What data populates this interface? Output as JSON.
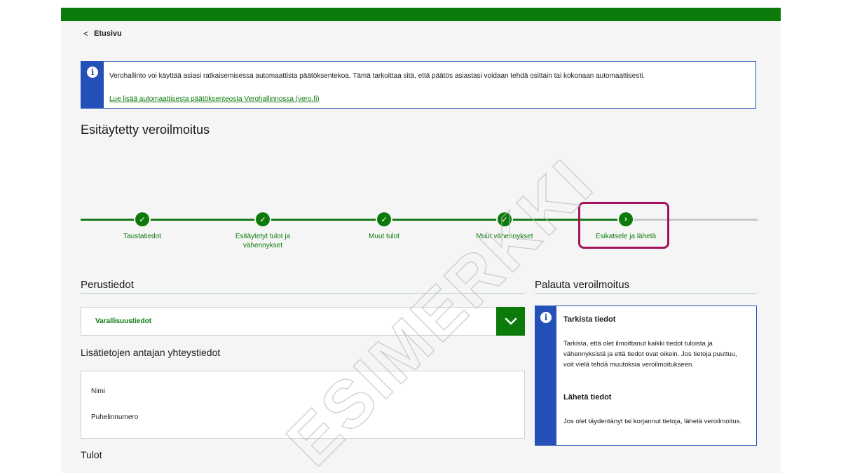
{
  "colors": {
    "brand_green": "#0b7a0b",
    "info_blue": "#2451b7",
    "highlight": "#a4145f"
  },
  "nav": {
    "back_label": "Etusivu"
  },
  "notice": {
    "text": "Verohallinto voi käyttää asiasi ratkaisemisessa automaattista päätöksentekoa. Tämä tarkoittaa sitä, että päätös asiastasi voidaan tehdä osittain tai kokonaan automaattisesti.",
    "link": "Lue lisää automaattisesta päätöksenteosta Verohallinnossa (vero.fi)"
  },
  "page_title": "Esitäytetty veroilmoitus",
  "stepper": {
    "steps": [
      {
        "label": "Taustatiedot",
        "state": "done",
        "icon": "check-icon"
      },
      {
        "label": "Esitäytetyt tulot ja vähennykset",
        "state": "done",
        "icon": "check-icon"
      },
      {
        "label": "Muut tulot",
        "state": "done",
        "icon": "check-icon"
      },
      {
        "label": "Muut vähennykset",
        "state": "done",
        "icon": "check-icon"
      },
      {
        "label": "Esikatsele ja lähetä",
        "state": "current",
        "icon": "chevron-right-icon"
      }
    ]
  },
  "main": {
    "perustiedot_heading": "Perustiedot",
    "accordion_label": "Varallisuustiedot",
    "contact_heading": "Lisätietojen antajan yhteystiedot",
    "contact_fields": [
      "Nimi",
      "Puhelinnumero"
    ],
    "tulot_heading": "Tulot"
  },
  "sidebar": {
    "heading": "Palauta veroilmoitus",
    "check_heading": "Tarkista tiedot",
    "check_text": "Tarkista, että olet ilmoittanut kaikki tiedot tuloista ja vähennyksistä ja että tiedot ovat oikein. Jos tietoja puuttuu, voit vielä tehdä muutoksia veroilmoitukseen.",
    "send_heading": "Lähetä tiedot",
    "send_text": "Jos olet täydentänyt tai korjannut tietoja, lähetä veroilmoitus."
  },
  "watermark": "ESIMERKKI"
}
